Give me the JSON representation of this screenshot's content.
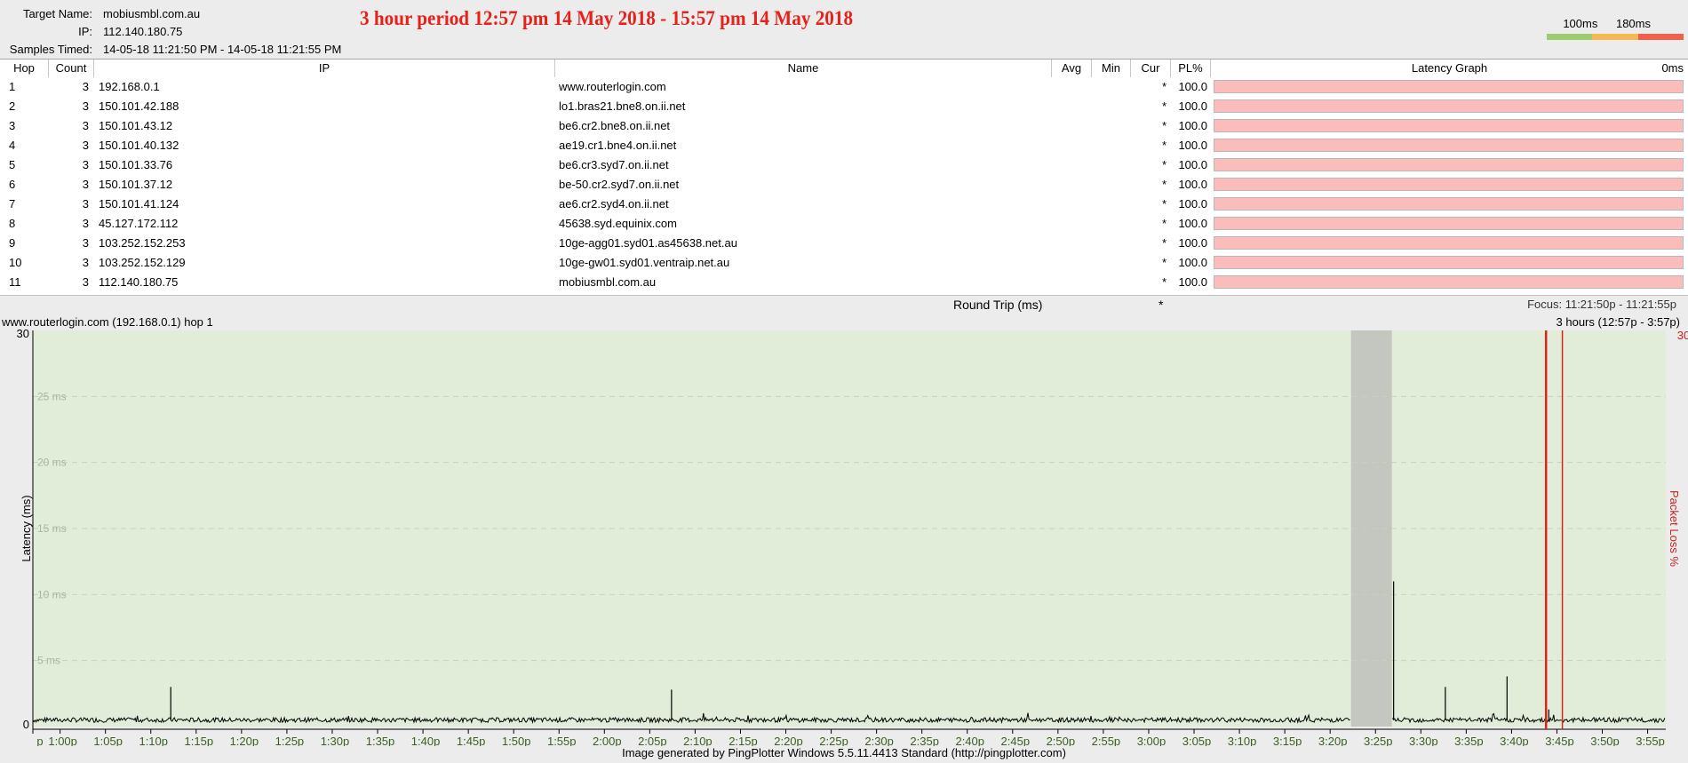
{
  "header": {
    "target_name_label": "Target Name:",
    "target_name": "mobiusmbl.com.au",
    "ip_label": "IP:",
    "ip": "112.140.180.75",
    "samples_label": "Samples Timed:",
    "samples": "14-05-18 11:21:50 PM - 14-05-18 11:21:55 PM",
    "banner": "3 hour period 12:57 pm 14 May 2018 - 15:57 pm 14 May 2018",
    "legend_100": "100ms",
    "legend_180": "180ms",
    "legend_colors": [
      "#9ccc70",
      "#f7b955",
      "#f0604c"
    ]
  },
  "table": {
    "columns": [
      "Hop",
      "Count",
      "IP",
      "Name",
      "Avg",
      "Min",
      "Cur",
      "PL%",
      "Latency Graph",
      "0ms"
    ],
    "rows": [
      {
        "hop": "1",
        "count": "3",
        "ip": "192.168.0.1",
        "name": "www.routerlogin.com",
        "avg": "",
        "min": "",
        "cur": "*",
        "pl": "100.0"
      },
      {
        "hop": "2",
        "count": "3",
        "ip": "150.101.42.188",
        "name": "lo1.bras21.bne8.on.ii.net",
        "avg": "",
        "min": "",
        "cur": "*",
        "pl": "100.0"
      },
      {
        "hop": "3",
        "count": "3",
        "ip": "150.101.43.12",
        "name": "be6.cr2.bne8.on.ii.net",
        "avg": "",
        "min": "",
        "cur": "*",
        "pl": "100.0"
      },
      {
        "hop": "4",
        "count": "3",
        "ip": "150.101.40.132",
        "name": "ae19.cr1.bne4.on.ii.net",
        "avg": "",
        "min": "",
        "cur": "*",
        "pl": "100.0"
      },
      {
        "hop": "5",
        "count": "3",
        "ip": "150.101.33.76",
        "name": "be6.cr3.syd7.on.ii.net",
        "avg": "",
        "min": "",
        "cur": "*",
        "pl": "100.0"
      },
      {
        "hop": "6",
        "count": "3",
        "ip": "150.101.37.12",
        "name": "be-50.cr2.syd7.on.ii.net",
        "avg": "",
        "min": "",
        "cur": "*",
        "pl": "100.0"
      },
      {
        "hop": "7",
        "count": "3",
        "ip": "150.101.41.124",
        "name": "ae6.cr2.syd4.on.ii.net",
        "avg": "",
        "min": "",
        "cur": "*",
        "pl": "100.0"
      },
      {
        "hop": "8",
        "count": "3",
        "ip": "45.127.172.112",
        "name": "45638.syd.equinix.com",
        "avg": "",
        "min": "",
        "cur": "*",
        "pl": "100.0"
      },
      {
        "hop": "9",
        "count": "3",
        "ip": "103.252.152.253",
        "name": "10ge-agg01.syd01.as45638.net.au",
        "avg": "",
        "min": "",
        "cur": "*",
        "pl": "100.0"
      },
      {
        "hop": "10",
        "count": "3",
        "ip": "103.252.152.129",
        "name": "10ge-gw01.syd01.ventraip.net.au",
        "avg": "",
        "min": "",
        "cur": "*",
        "pl": "100.0"
      },
      {
        "hop": "11",
        "count": "3",
        "ip": "112.140.180.75",
        "name": "mobiusmbl.com.au",
        "avg": "",
        "min": "",
        "cur": "*",
        "pl": "100.0"
      }
    ],
    "round_trip_label": "Round Trip (ms)",
    "round_trip_cur": "*",
    "focus": "Focus: 11:21:50p - 11:21:55p"
  },
  "graph": {
    "title": "www.routerlogin.com (192.168.0.1) hop 1",
    "range": "3 hours (12:57p - 3:57p)",
    "footer": "Image generated by PingPlotter Windows 5.5.11.4413 Standard (http://pingplotter.com)"
  },
  "chart_data": {
    "type": "line",
    "xlabel": "",
    "ylabel": "Latency (ms)",
    "y2label": "Packet Loss %",
    "ylim": [
      0,
      30
    ],
    "y_ticks": [
      {
        "value": 0,
        "label": "0"
      },
      {
        "value": 5,
        "label": "5 ms"
      },
      {
        "value": 10,
        "label": "10 ms"
      },
      {
        "value": 15,
        "label": "15 ms"
      },
      {
        "value": 20,
        "label": "20 ms"
      },
      {
        "value": 25,
        "label": "25 ms"
      },
      {
        "value": 30,
        "label": "30"
      }
    ],
    "y2_max_label": "30",
    "x_start_min": 0,
    "x_end_min": 180,
    "x_ticks": [
      {
        "min": 0,
        "label": "p"
      },
      {
        "min": 3,
        "label": "1:00p"
      },
      {
        "min": 8,
        "label": "1:05p"
      },
      {
        "min": 13,
        "label": "1:10p"
      },
      {
        "min": 18,
        "label": "1:15p"
      },
      {
        "min": 23,
        "label": "1:20p"
      },
      {
        "min": 28,
        "label": "1:25p"
      },
      {
        "min": 33,
        "label": "1:30p"
      },
      {
        "min": 38,
        "label": "1:35p"
      },
      {
        "min": 43,
        "label": "1:40p"
      },
      {
        "min": 48,
        "label": "1:45p"
      },
      {
        "min": 53,
        "label": "1:50p"
      },
      {
        "min": 58,
        "label": "1:55p"
      },
      {
        "min": 63,
        "label": "2:00p"
      },
      {
        "min": 68,
        "label": "2:05p"
      },
      {
        "min": 73,
        "label": "2:10p"
      },
      {
        "min": 78,
        "label": "2:15p"
      },
      {
        "min": 83,
        "label": "2:20p"
      },
      {
        "min": 88,
        "label": "2:25p"
      },
      {
        "min": 93,
        "label": "2:30p"
      },
      {
        "min": 98,
        "label": "2:35p"
      },
      {
        "min": 103,
        "label": "2:40p"
      },
      {
        "min": 108,
        "label": "2:45p"
      },
      {
        "min": 113,
        "label": "2:50p"
      },
      {
        "min": 118,
        "label": "2:55p"
      },
      {
        "min": 123,
        "label": "3:00p"
      },
      {
        "min": 128,
        "label": "3:05p"
      },
      {
        "min": 133,
        "label": "3:10p"
      },
      {
        "min": 138,
        "label": "3:15p"
      },
      {
        "min": 143,
        "label": "3:20p"
      },
      {
        "min": 148,
        "label": "3:25p"
      },
      {
        "min": 153,
        "label": "3:30p"
      },
      {
        "min": 158,
        "label": "3:35p"
      },
      {
        "min": 163,
        "label": "3:40p"
      },
      {
        "min": 168,
        "label": "3:45p"
      },
      {
        "min": 173,
        "label": "3:50p"
      },
      {
        "min": 178,
        "label": "3:55p"
      }
    ],
    "baseline_ms": 0.5,
    "gap_region_min": [
      145.3,
      149.8
    ],
    "spikes": [
      {
        "min": 15.2,
        "ms": 3.0
      },
      {
        "min": 70.4,
        "ms": 2.8
      },
      {
        "min": 150.0,
        "ms": 11.0
      },
      {
        "min": 155.7,
        "ms": 3.0
      },
      {
        "min": 162.5,
        "ms": 3.8
      },
      {
        "min": 167.1,
        "ms": 1.3
      }
    ],
    "packet_loss_markers_min": [
      166.8,
      168.6
    ],
    "colors": {
      "plot_bg": "#e1edd8",
      "gap": "#c4c7bf",
      "line": "#000000",
      "packet_loss": "#d9261c",
      "right_axis": "#cc1f1f",
      "x_tick_text": "#3a5f1e"
    }
  }
}
